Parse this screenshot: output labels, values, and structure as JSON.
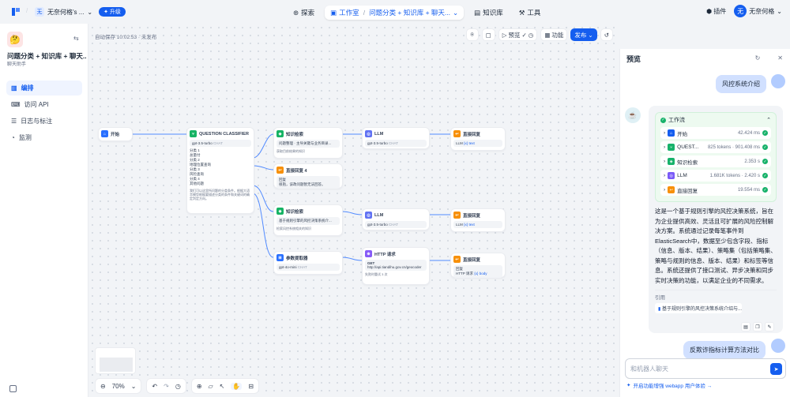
{
  "topbar": {
    "workspace": "无奈何格's ...",
    "workspace_initial": "无",
    "upgrade": "升级",
    "nav": [
      {
        "label": "探索"
      },
      {
        "label": "工作室"
      },
      {
        "label": "问题分类 + 知识库 + 聊天..."
      },
      {
        "label": "知识库"
      },
      {
        "label": "工具"
      }
    ],
    "plugins": "插件",
    "user": "无奈何格",
    "user_initial": "无"
  },
  "sidebar": {
    "app_emoji": "🤔",
    "app_title": "问题分类 + 知识库 + 聊天...",
    "app_sub": "聊天助手",
    "menu": [
      {
        "label": "编排"
      },
      {
        "label": "访问 API"
      },
      {
        "label": "日志与标注"
      },
      {
        "label": "监测"
      }
    ]
  },
  "canvas": {
    "autosave": "自动保存 10:02:53 · 未发布",
    "preview_btn": "预览",
    "features_btn": "功能",
    "publish_btn": "发布",
    "zoom": "70%"
  },
  "nodes": {
    "start": {
      "title": "开始"
    },
    "qc": {
      "title": "QUESTION CLASSIFIER",
      "model": "gpt-3.5-turbo",
      "tag": "CHAT",
      "classes": [
        {
          "k": "分类 1",
          "v": "总量付"
        },
        {
          "k": "分类 2",
          "v": "地理位置查询"
        },
        {
          "k": "分类 3",
          "v": "风险查询"
        },
        {
          "k": "分类 4",
          "v": "其他问题"
        }
      ],
      "desc": "我们可以这里所问题的分类条件。根据大语言模型根据要描述分类的条件和关键词的确定判定方向。"
    },
    "kr1": {
      "title": "知识检索",
      "row": "问题整理 · 主导关键与业务目录...",
      "desc": "获取目前结果的知识"
    },
    "llm1": {
      "title": "LLM",
      "model": "gpt-3.5-turbo",
      "tag": "CHAT"
    },
    "ans1": {
      "title": "直接回复",
      "row": "LLM",
      "rowtag": "{x} text"
    },
    "ans4": {
      "title": "直接回复 4",
      "k": "回复",
      "v": "很抱，该政问题暂无法回答。"
    },
    "kr2": {
      "title": "知识检索",
      "row": "基于规则引擎的风控决策系统介...",
      "desc": "检索风控系统相关的知识"
    },
    "llm2": {
      "title": "LLM",
      "model": "gpt-3.5-turbo",
      "tag": "CHAT"
    },
    "ans2": {
      "title": "直接回复",
      "row": "LLM",
      "rowtag": "{x} text"
    },
    "param": {
      "title": "参数提取器",
      "model": "gpt-4o-mini",
      "tag": "CHAT"
    },
    "http": {
      "title": "HTTP 请求",
      "method": "GET",
      "url": "http://api.tiandihu.gov.cn/geocoder",
      "retry": "失败时重试 3 次"
    },
    "ans3": {
      "title": "直接回复",
      "k": "回复",
      "row": "HTTP 请求",
      "rowtag": "{x} body"
    }
  },
  "preview": {
    "title": "预览",
    "user_msg1": "风控系统介绍",
    "workflow_label": "工作流",
    "workflow": [
      {
        "name": "开始",
        "time": "42.424 ms",
        "color": "#155eef"
      },
      {
        "name": "QUEST...",
        "time": "825 tokens · 901.408 ms",
        "color": "#17b26a"
      },
      {
        "name": "知识检索",
        "time": "2.353 s",
        "color": "#17b26a"
      },
      {
        "name": "LLM",
        "time": "1.681K tokens · 2.420 s",
        "color": "#7a5af8"
      },
      {
        "name": "直接回复",
        "time": "19.554 ms",
        "color": "#f79009"
      }
    ],
    "answer": "这是一个基于规则引擎的风控决策系统，旨在为企业提供高效、灵活且可扩展的风险控制解决方案。系统通过记录每笔事件到ElasticSearch中，数据至少包含字段、指标（信息、版本、结果）、策略集（包括策略集、策略与规则的信息、版本、结果）和标签等信息。系统还提供了接口测试、异步决策和同步实时决策的功能，以满足企业的不同需求。",
    "cite_label": "引用",
    "cite_item": "基于规则引擎的风控决策系统介绍与...",
    "user_msg2": "反欺诈指标计算方法对比",
    "input_placeholder": "和机器人聊天",
    "footer": "开启功能增强 webapp 用户体验 →"
  }
}
